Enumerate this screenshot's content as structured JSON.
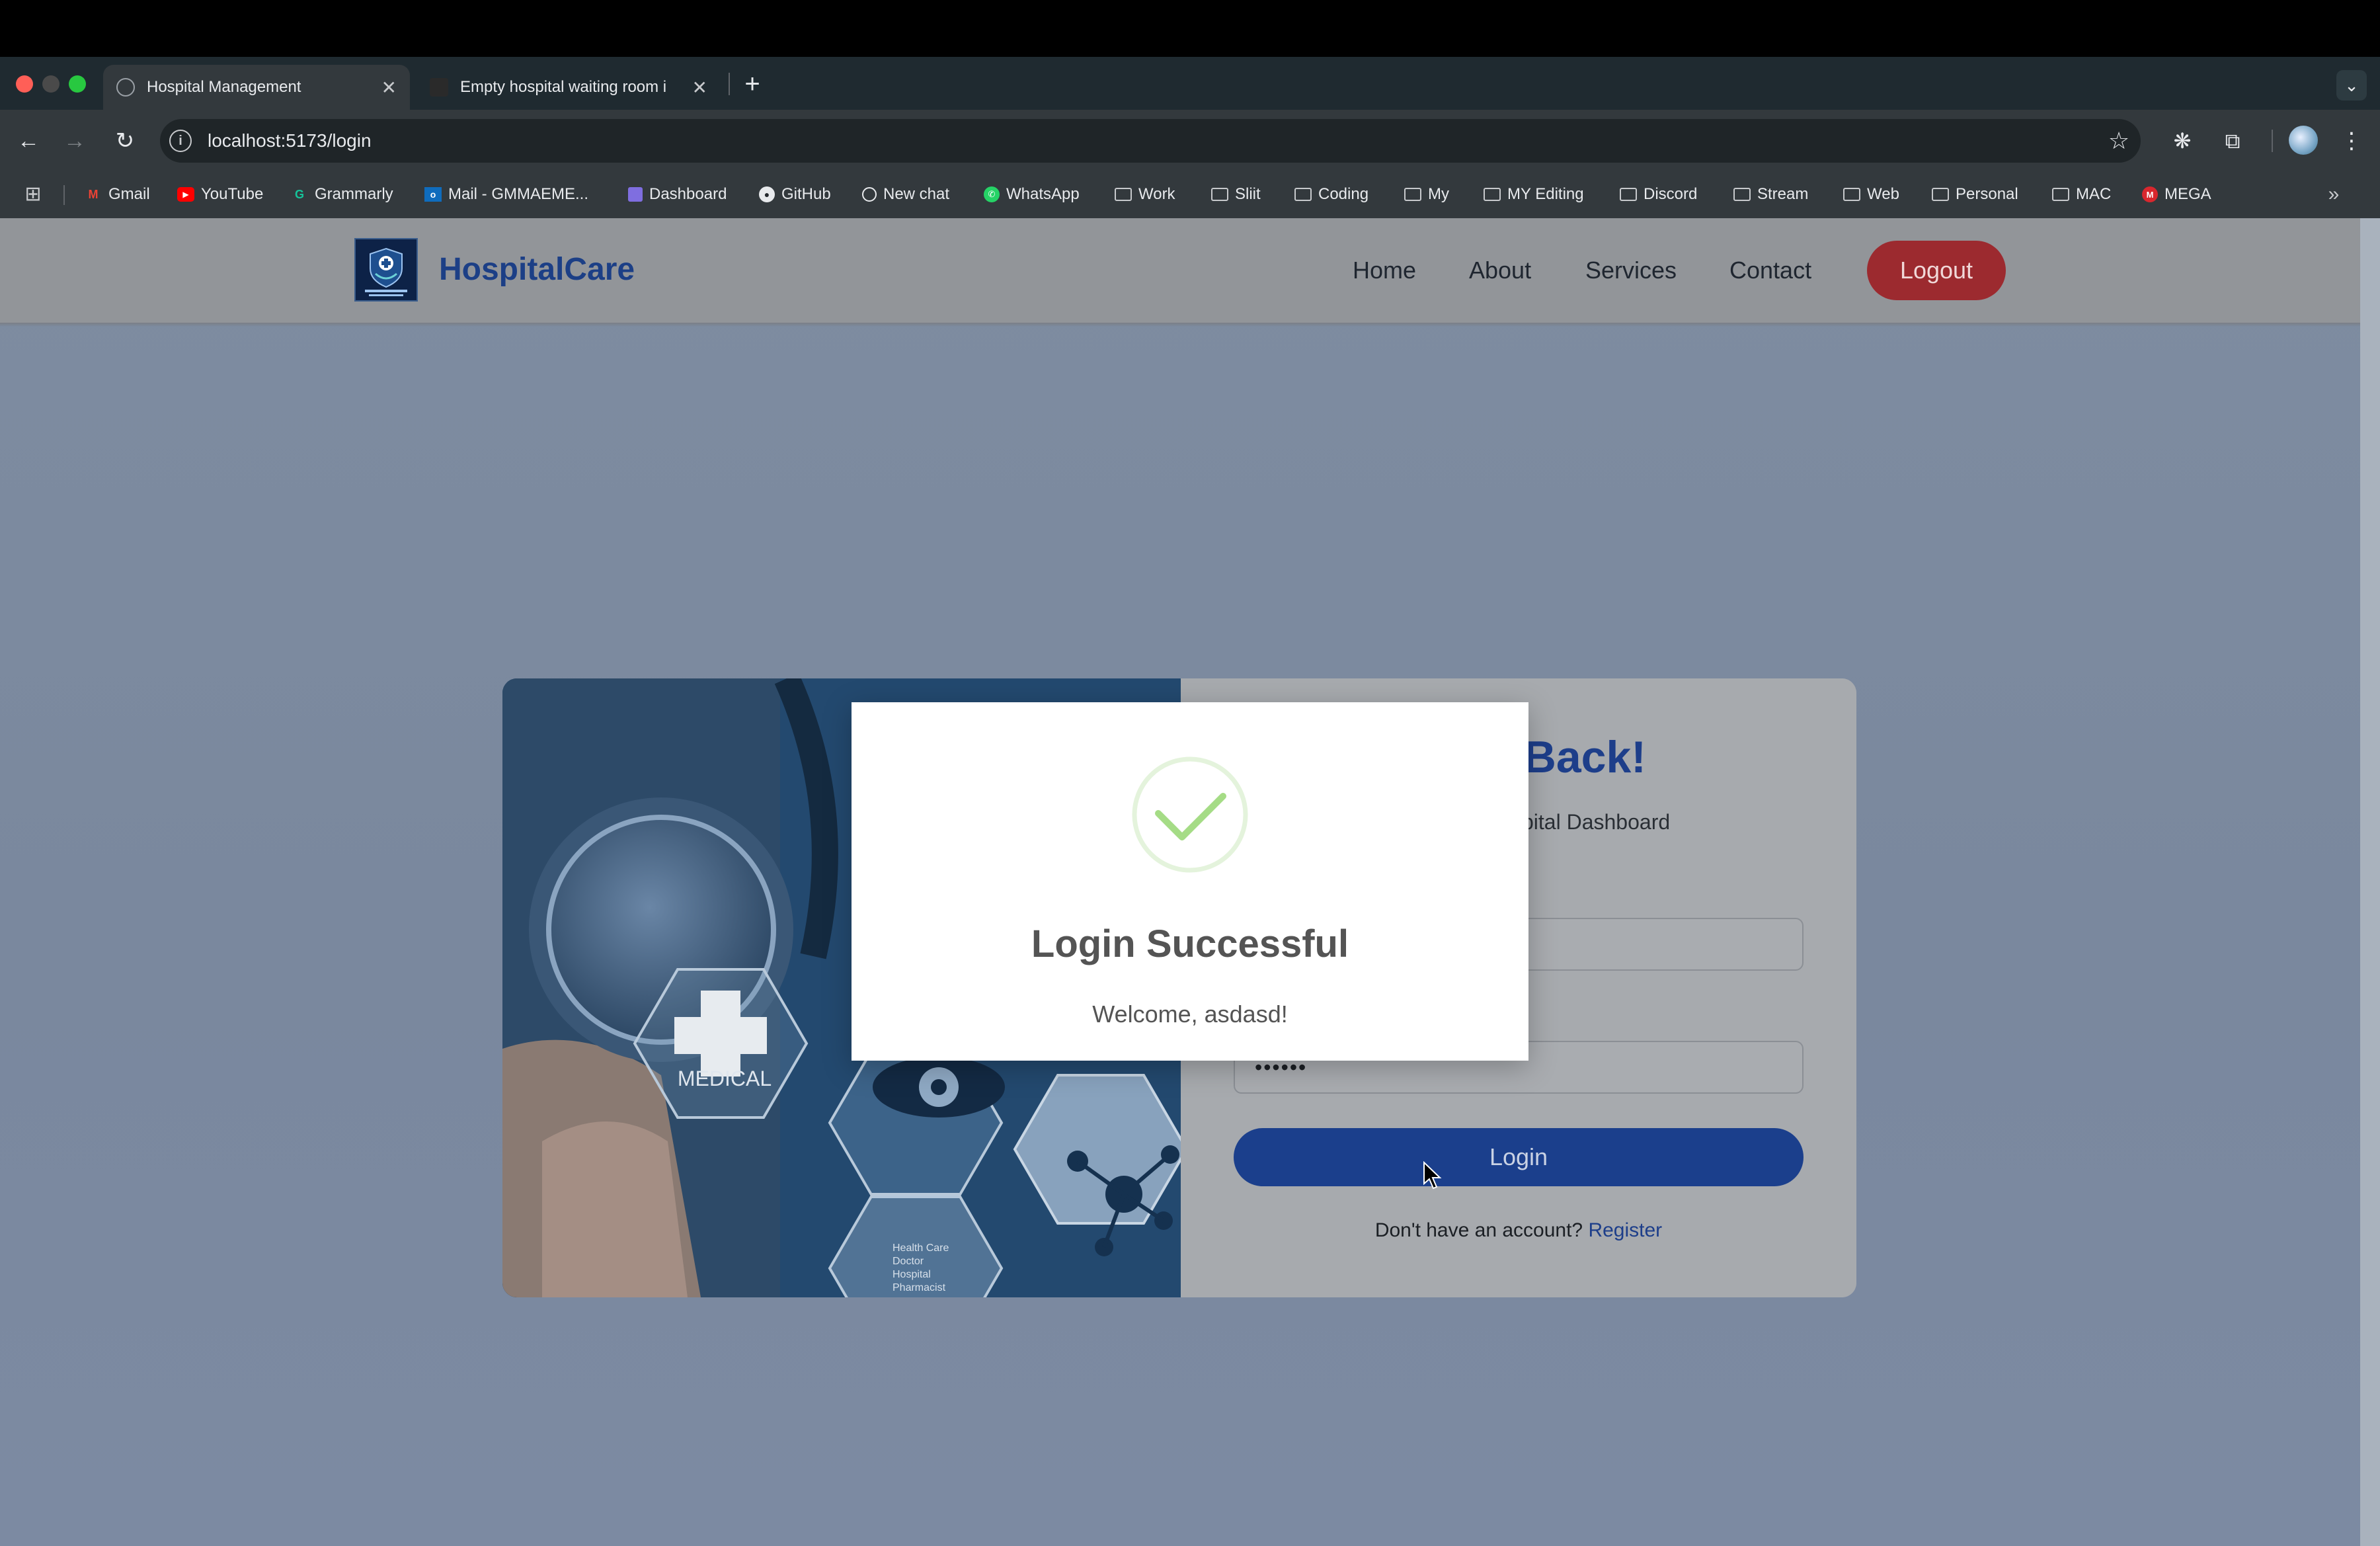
{
  "browser": {
    "tabs": [
      {
        "title": "Hospital Management",
        "active": true
      },
      {
        "title": "Empty hospital waiting room i",
        "active": false
      }
    ],
    "url": "localhost:5173/login",
    "bookmarks": [
      {
        "label": "Gmail",
        "icon": "gmail-icon"
      },
      {
        "label": "YouTube",
        "icon": "youtube-icon"
      },
      {
        "label": "Grammarly",
        "icon": "grammarly-icon"
      },
      {
        "label": "Mail - GMMAEME...",
        "icon": "outlook-icon"
      },
      {
        "label": "Dashboard",
        "icon": "dashboard-icon"
      },
      {
        "label": "GitHub",
        "icon": "github-icon"
      },
      {
        "label": "New chat",
        "icon": "chatgpt-icon"
      },
      {
        "label": "WhatsApp",
        "icon": "whatsapp-icon"
      },
      {
        "label": "Work",
        "icon": "folder-icon"
      },
      {
        "label": "Sliit",
        "icon": "folder-icon"
      },
      {
        "label": "Coding",
        "icon": "folder-icon"
      },
      {
        "label": "My",
        "icon": "folder-icon"
      },
      {
        "label": "MY Editing",
        "icon": "folder-icon"
      },
      {
        "label": "Discord",
        "icon": "folder-icon"
      },
      {
        "label": "Stream",
        "icon": "folder-icon"
      },
      {
        "label": "Web",
        "icon": "folder-icon"
      },
      {
        "label": "Personal",
        "icon": "folder-icon"
      },
      {
        "label": "MAC",
        "icon": "folder-icon"
      },
      {
        "label": "MEGA",
        "icon": "mega-icon"
      }
    ]
  },
  "navbar": {
    "brand": "HospitalCare",
    "links": [
      "Home",
      "About",
      "Services",
      "Contact"
    ],
    "logout_label": "Logout"
  },
  "login": {
    "title_visible": "e Back!",
    "subtitle_visible": "pital Dashboard",
    "password_value": "••••••",
    "login_label": "Login",
    "register_prompt": "Don't have an account?",
    "register_link": "Register"
  },
  "illustration": {
    "labels": [
      "MEDICAL",
      "Health Care",
      "Doctor",
      "Hospital",
      "Pharmacist"
    ]
  },
  "modal": {
    "title": "Login Successful",
    "message": "Welcome, asdasd!",
    "icon": "check-circle-icon"
  },
  "colors": {
    "brand": "#1c3f86",
    "logout": "#c62f35",
    "login_button": "#2f6ad9",
    "success_check": "#a5dc86"
  }
}
